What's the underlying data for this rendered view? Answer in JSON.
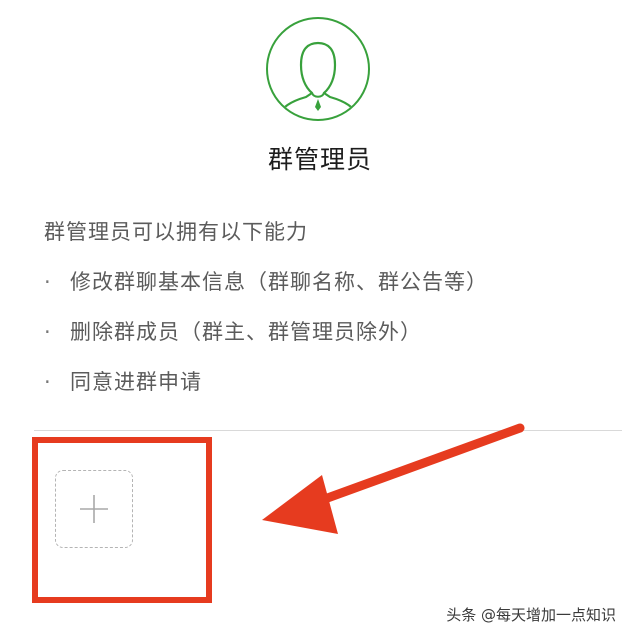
{
  "role": {
    "title": "群管理员",
    "avatar_icon": "user-silhouette-icon",
    "accent_color": "#38a13c"
  },
  "description": {
    "intro": "群管理员可以拥有以下能力",
    "bullet": "·",
    "abilities": [
      "修改群聊基本信息（群聊名称、群公告等）",
      "删除群成员（群主、群管理员除外）",
      "同意进群申请"
    ]
  },
  "add_admin": {
    "icon": "plus-icon"
  },
  "annotation": {
    "color": "#e63b1f"
  },
  "watermark": {
    "text": "头条 @每天增加一点知识"
  }
}
